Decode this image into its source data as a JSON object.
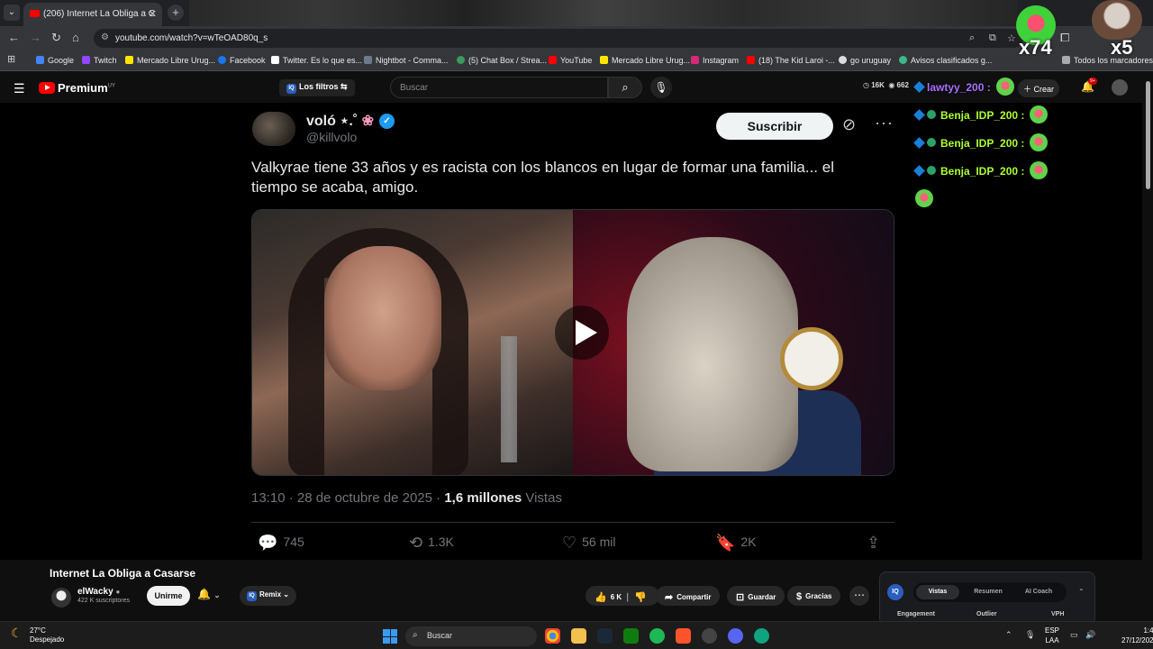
{
  "browser": {
    "tab_title": "(206) Internet La Obliga a C",
    "url": "youtube.com/watch?v=wTeOAD80q_s",
    "bookmarks": [
      "Google",
      "Twitch",
      "Mercado Libre Urug...",
      "Facebook",
      "Twitter. Es lo que es...",
      "Nightbot - Comma...",
      "(5) Chat Box / Strea...",
      "YouTube",
      "Mercado Libre Urug...",
      "Instagram",
      "(18) The Kid Laroi -...",
      "go uruguay",
      "Avisos clasificados g..."
    ],
    "bookmarks_folder": "Todos los marcadores"
  },
  "youtube_header": {
    "logo": "Premium",
    "logo_region": "UY",
    "filters_label": "Los filtros",
    "search_placeholder": "Buscar",
    "stat_1": "16K",
    "stat_2": "662",
    "create_label": "Crear",
    "notif_badge": "9+"
  },
  "post": {
    "display_name": "voló ⋆.˚",
    "handle": "@killvolo",
    "subscribe_label": "Suscribir",
    "text": "Valkyrae tiene 33 años y es racista con los blancos en lugar de formar una familia... el tiempo se acaba, amigo.",
    "timestamp": "13:10 · 28 de octubre de 2025 · ",
    "views_count": "1,6 millones",
    "views_label": " Vistas",
    "replies": "745",
    "reposts": "1.3K",
    "likes": "56 mil",
    "bookmarks": "2K"
  },
  "chat": {
    "top_user": "lawtyy_200 :",
    "lines": [
      "Benja_IDP_200 :",
      "Benja_IDP_200 :",
      "Benja_IDP_200 :"
    ],
    "overlay_1": "x74",
    "overlay_2": "x5"
  },
  "video": {
    "title": "Internet La Obliga a Casarse",
    "channel": "elWacky",
    "subscribers": "422 K suscriptores",
    "join_label": "Unirme",
    "remix_label": "Remix",
    "likes": "6 K",
    "share_label": "Compartir",
    "save_label": "Guardar",
    "thanks_label": "Gracias"
  },
  "vidiq": {
    "tabs": [
      "Vistas",
      "Resumen",
      "AI Coach"
    ],
    "columns": [
      "Engagement",
      "Outlier",
      "VPH"
    ]
  },
  "taskbar": {
    "temperature": "27°C",
    "weather": "Despejado",
    "search_label": "Buscar",
    "lang_1": "ESP",
    "lang_2": "LAA",
    "time": "1:42",
    "date": "27/12/2025"
  }
}
